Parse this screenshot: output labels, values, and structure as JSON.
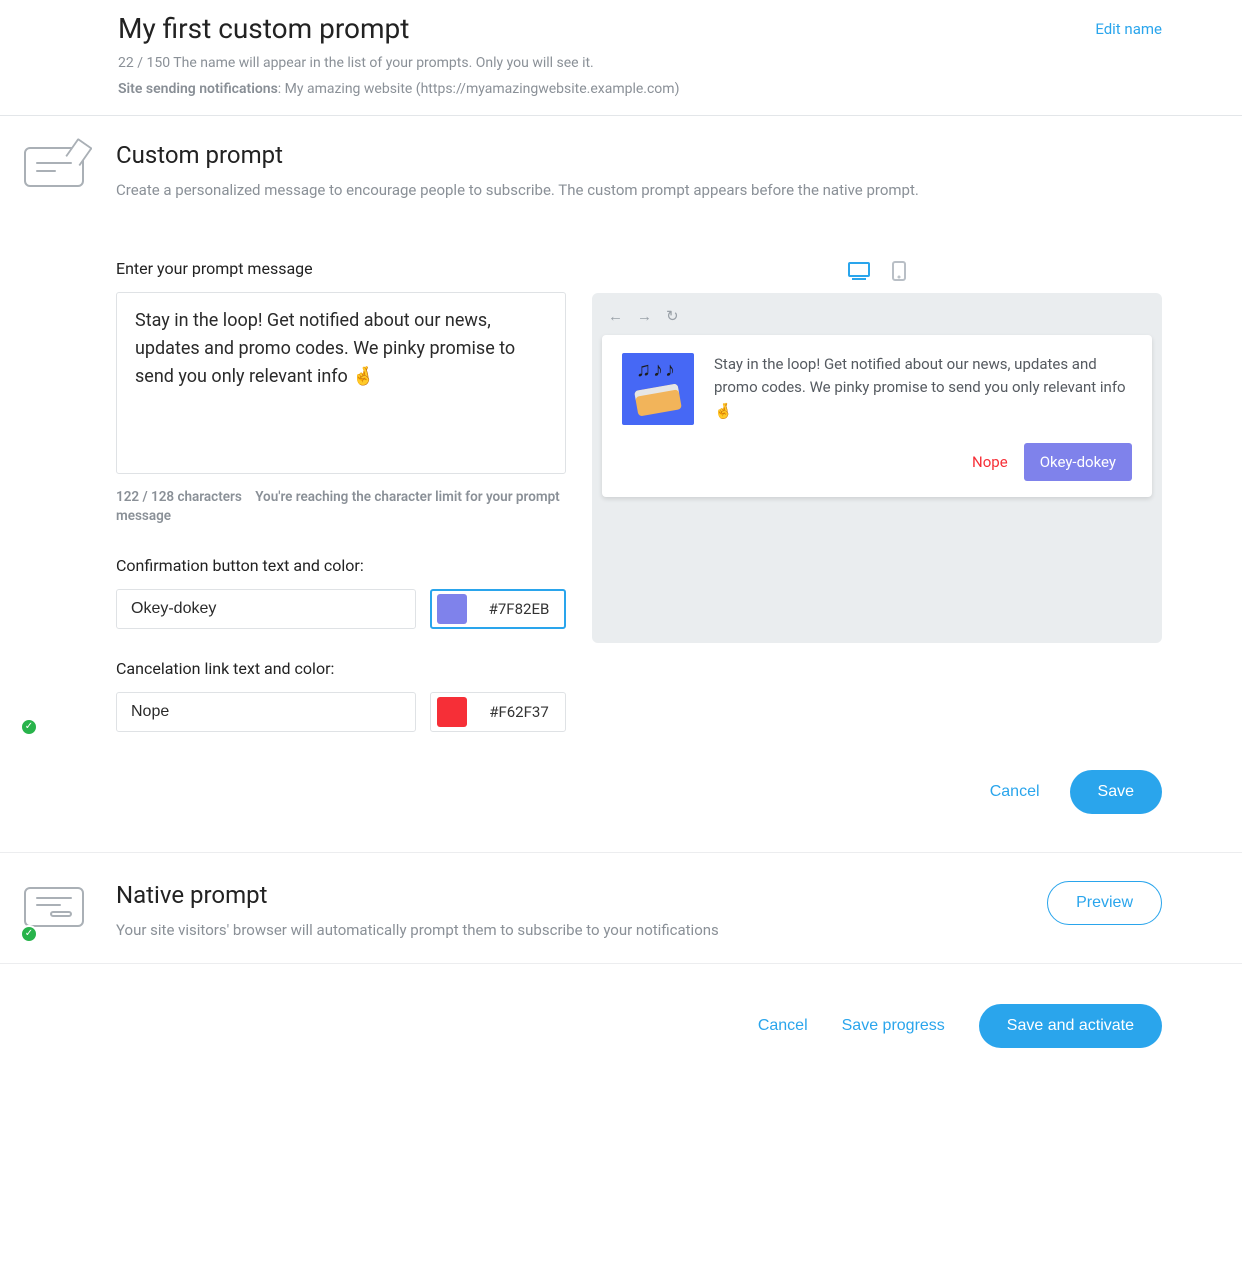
{
  "header": {
    "title": "My first custom prompt",
    "edit_name": "Edit name",
    "counter": "22 / 150",
    "counter_hint": "The name will appear in the list of your prompts. Only you will see it.",
    "site_label": "Site sending notifications",
    "site_value": ": My amazing website (https://myamazingwebsite.example.com)"
  },
  "custom": {
    "title": "Custom prompt",
    "desc": "Create a personalized message to encourage people to subscribe. The custom prompt appears before the native prompt.",
    "msg_label": "Enter your prompt message",
    "msg_value": "Stay in the loop! Get notified about our news, updates and promo codes. We pinky promise to send you only relevant info 🤞",
    "msg_count": "122 / 128 characters",
    "msg_hint": "You're reaching the character limit for your prompt message",
    "confirm_label": "Confirmation button text and color:",
    "confirm_text": "Okey-dokey",
    "confirm_color": "#7F82EB",
    "cancel_label": "Cancelation link text and color:",
    "cancel_text": "Nope",
    "cancel_color": "#F62F37",
    "actions": {
      "cancel": "Cancel",
      "save": "Save"
    }
  },
  "preview": {
    "message": "Stay in the loop! Get notified about our news, updates and promo codes. We pinky promise to send you only relevant info 🤞",
    "cancel": "Nope",
    "confirm": "Okey-dokey",
    "confirm_bg": "#7F82EB",
    "cancel_color": "#F62F37"
  },
  "native": {
    "title": "Native prompt",
    "desc": "Your site visitors' browser will automatically prompt them to subscribe to your notifications",
    "preview": "Preview"
  },
  "footer": {
    "cancel": "Cancel",
    "save_progress": "Save progress",
    "save_activate": "Save and activate"
  }
}
